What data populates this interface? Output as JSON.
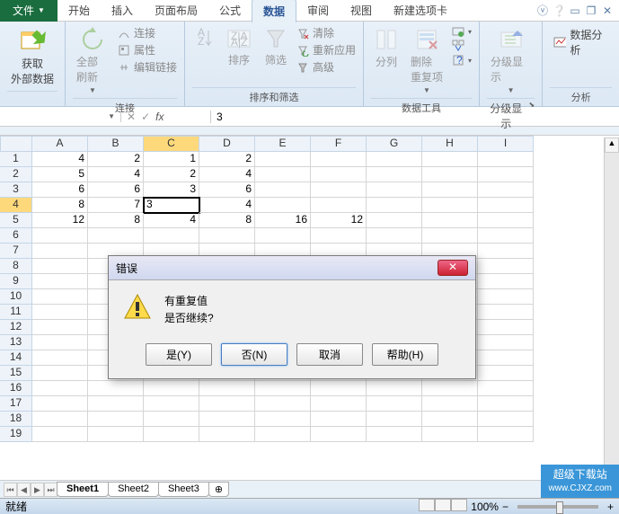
{
  "tabs": {
    "file": "文件",
    "home": "开始",
    "insert": "插入",
    "layout": "页面布局",
    "formula": "公式",
    "data": "数据",
    "review": "审阅",
    "view": "视图",
    "newtab": "新建选项卡"
  },
  "ribbon": {
    "get_data": "获取\n外部数据",
    "refresh": "全部刷新",
    "conn_group": "连接",
    "conn": "连接",
    "prop": "属性",
    "edit_link": "编辑链接",
    "sort_group": "排序和筛选",
    "sort": "排序",
    "filter": "筛选",
    "clear": "清除",
    "reapply": "重新应用",
    "advanced": "高级",
    "tools_group": "数据工具",
    "ttc": "分列",
    "rmdup": "删除\n重复项",
    "outline_group": "分级显示",
    "outline": "分级显示",
    "analysis_group": "分析",
    "analysis": "数据分析"
  },
  "namebox": "",
  "formula": "3",
  "cols": [
    "A",
    "B",
    "C",
    "D",
    "E",
    "F",
    "G",
    "H",
    "I"
  ],
  "active_col_idx": 2,
  "active_row_idx": 3,
  "row_nums": [
    "1",
    "2",
    "3",
    "4",
    "5",
    "6",
    "7",
    "8",
    "9",
    "10",
    "11",
    "12",
    "13",
    "14",
    "15",
    "16",
    "17",
    "18",
    "19"
  ],
  "chart_data": {
    "type": "table",
    "rows": [
      [
        "4",
        "2",
        "1",
        "2",
        "",
        "",
        "",
        "",
        ""
      ],
      [
        "5",
        "4",
        "2",
        "4",
        "",
        "",
        "",
        "",
        ""
      ],
      [
        "6",
        "6",
        "3",
        "6",
        "",
        "",
        "",
        "",
        ""
      ],
      [
        "8",
        "7",
        "3",
        "4",
        "",
        "",
        "",
        "",
        ""
      ],
      [
        "12",
        "8",
        "4",
        "8",
        "16",
        "12",
        "",
        "",
        ""
      ],
      [
        "",
        "",
        "",
        "",
        "",
        "",
        "",
        "",
        ""
      ],
      [
        "",
        "",
        "",
        "",
        "",
        "",
        "",
        "",
        ""
      ],
      [
        "",
        "",
        "",
        "",
        "",
        "",
        "",
        "",
        ""
      ],
      [
        "",
        "",
        "",
        "",
        "",
        "",
        "",
        "",
        ""
      ],
      [
        "",
        "",
        "",
        "",
        "",
        "",
        "",
        "",
        ""
      ],
      [
        "",
        "",
        "",
        "",
        "",
        "",
        "",
        "",
        ""
      ],
      [
        "",
        "",
        "",
        "",
        "",
        "",
        "",
        "",
        ""
      ],
      [
        "",
        "",
        "",
        "",
        "",
        "",
        "",
        "",
        ""
      ],
      [
        "",
        "",
        "",
        "",
        "",
        "",
        "",
        "",
        ""
      ],
      [
        "",
        "",
        "",
        "",
        "",
        "",
        "",
        "",
        ""
      ],
      [
        "",
        "",
        "",
        "",
        "",
        "",
        "",
        "",
        ""
      ],
      [
        "",
        "",
        "",
        "",
        "",
        "",
        "",
        "",
        ""
      ],
      [
        "",
        "",
        "",
        "",
        "",
        "",
        "",
        "",
        ""
      ],
      [
        "",
        "",
        "",
        "",
        "",
        "",
        "",
        "",
        ""
      ]
    ]
  },
  "dialog": {
    "title": "错误",
    "msg1": "有重复值",
    "msg2": "是否继续?",
    "yes": "是(Y)",
    "no": "否(N)",
    "cancel": "取消",
    "help": "帮助(H)"
  },
  "sheets": [
    "Sheet1",
    "Sheet2",
    "Sheet3"
  ],
  "status": {
    "ready": "就绪",
    "zoom": "100%"
  },
  "watermark": {
    "t": "超级下载站",
    "u": "www.CJXZ.com"
  }
}
